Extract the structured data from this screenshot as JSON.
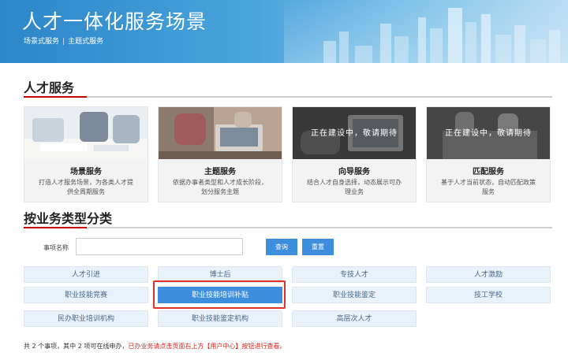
{
  "banner": {
    "title": "人才一体化服务场景",
    "nav": [
      "场景式服务",
      "主题式服务"
    ]
  },
  "talent_service": {
    "title": "人才服务",
    "cards": [
      {
        "title": "场景服务",
        "desc": "打造人才服务场景，为各类人才提供全周期服务",
        "overlay": ""
      },
      {
        "title": "主题服务",
        "desc": "依据办事者类型和人才成长阶段，划分服务主题",
        "overlay": ""
      },
      {
        "title": "向导服务",
        "desc": "结合人才自身选择，动态展示可办理业务",
        "overlay": "正在建设中，敬请期待"
      },
      {
        "title": "匹配服务",
        "desc": "基于人才当前状态，自动匹配政策服务",
        "overlay": "正在建设中，敬请期待"
      }
    ]
  },
  "business_type": {
    "title": "按业务类型分类",
    "search_label": "事项名称",
    "search_value": "",
    "search_placeholder": "",
    "query_label": "查询",
    "reset_label": "重置",
    "categories": [
      [
        "人才引进",
        "博士后",
        "专技人才",
        "人才激励"
      ],
      [
        "职业技能竞赛",
        "职业技能培训补贴",
        "职业技能鉴定",
        "技工学校"
      ],
      [
        "民办职业培训机构",
        "职业技能鉴定机构",
        "高层次人才"
      ]
    ],
    "active_category": "职业技能培训补贴"
  },
  "footer": {
    "note_prefix": "共 2 个事项，其中 2 项可在线申办，",
    "note_red": "已办业务请点击页面右上方【用户中心】按钮进行查看。"
  },
  "colors": {
    "accent": "#3d8fde",
    "section_rule": "#c40000",
    "highlight": "#e0312b"
  }
}
